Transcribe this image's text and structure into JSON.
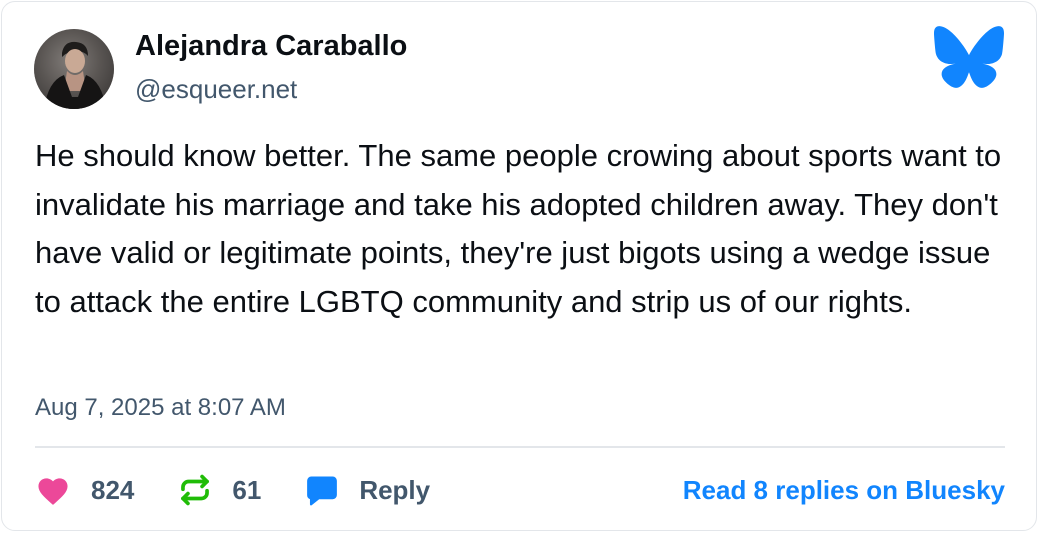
{
  "post": {
    "author_name": "Alejandra Caraballo",
    "author_handle": "@esqueer.net",
    "text": "He should know better. The same people crowing about sports want to invalidate his marriage and take his adopted children away. They don't have valid or legitimate points, they're just bigots using a wedge issue to attack the entire LGBTQ community and strip us of our rights.",
    "timestamp": "Aug 7, 2025 at 8:07 AM"
  },
  "actions": {
    "like_count": "824",
    "repost_count": "61",
    "reply_label": "Reply",
    "read_replies_label": "Read 8 replies on Bluesky"
  },
  "icons": {
    "avatar": "avatar",
    "logo": "bluesky-butterfly-icon",
    "like": "heart-icon",
    "repost": "repost-icon",
    "reply": "speech-bubble-icon"
  },
  "colors": {
    "brand_blue": "#1185fe",
    "like_pink": "#ec4899",
    "repost_green": "#20bc07",
    "secondary_text": "#42576c",
    "primary_text": "#0b0f14"
  }
}
